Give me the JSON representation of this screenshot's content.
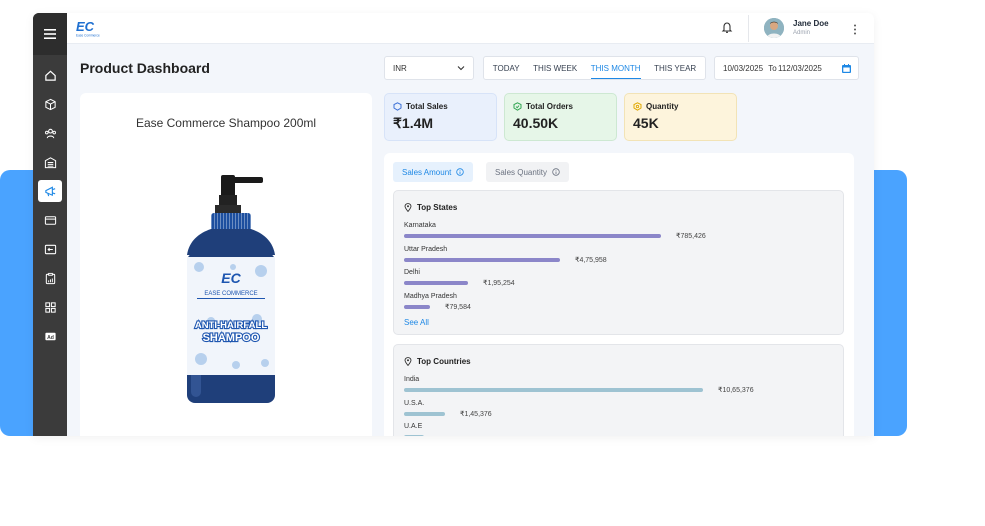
{
  "brand": {
    "logo_text": "EC",
    "tagline": "Ease Commerce"
  },
  "user": {
    "name": "Jane Doe",
    "role": "Admin"
  },
  "page": {
    "title": "Product Dashboard"
  },
  "filters": {
    "currency": "INR",
    "range_tabs": [
      {
        "label": "TODAY",
        "active": false
      },
      {
        "label": "THIS WEEK",
        "active": false
      },
      {
        "label": "THIS MONTH",
        "active": true
      },
      {
        "label": "THIS YEAR",
        "active": false
      }
    ],
    "date_from": "10/03/2025",
    "date_to_prefix": "To",
    "date_to": "112/03/2025"
  },
  "product": {
    "name": "Ease Commerce Shampoo 200ml",
    "label_brand": "EASE COMMERCE",
    "label_line1": "ANTI-HAIRFALL",
    "label_line2": "SHAMPOO"
  },
  "stats": {
    "sales": {
      "label": "Total Sales",
      "value": "₹1.4M"
    },
    "orders": {
      "label": "Total Orders",
      "value": "40.50K"
    },
    "quantity": {
      "label": "Quantity",
      "value": "45K"
    }
  },
  "toggles": {
    "amount": "Sales Amount",
    "quantity": "Sales Quantity"
  },
  "top_states": {
    "title": "Top States",
    "rows": [
      {
        "name": "Karnataka",
        "value": "₹785,426",
        "amount": 785426
      },
      {
        "name": "Uttar Pradesh",
        "value": "₹4,75,958",
        "amount": 475958
      },
      {
        "name": "Delhi",
        "value": "₹1,95,254",
        "amount": 195254
      },
      {
        "name": "Madhya Pradesh",
        "value": "₹79,584",
        "amount": 79584
      }
    ],
    "see_all": "See All"
  },
  "top_countries": {
    "title": "Top Countries",
    "rows": [
      {
        "name": "India",
        "value": "₹10,65,376",
        "amount": 1065376
      },
      {
        "name": "U.S.A.",
        "value": "₹1,45,376",
        "amount": 145376
      },
      {
        "name": "U.A.E",
        "value": "",
        "amount": 40000
      }
    ]
  },
  "colors": {
    "accent": "#1e88e5",
    "sidebar": "#3b3b3b",
    "state_bar": "#8b86c9",
    "country_bar": "#9ec3d2",
    "bottle": "#1f3f7a"
  }
}
